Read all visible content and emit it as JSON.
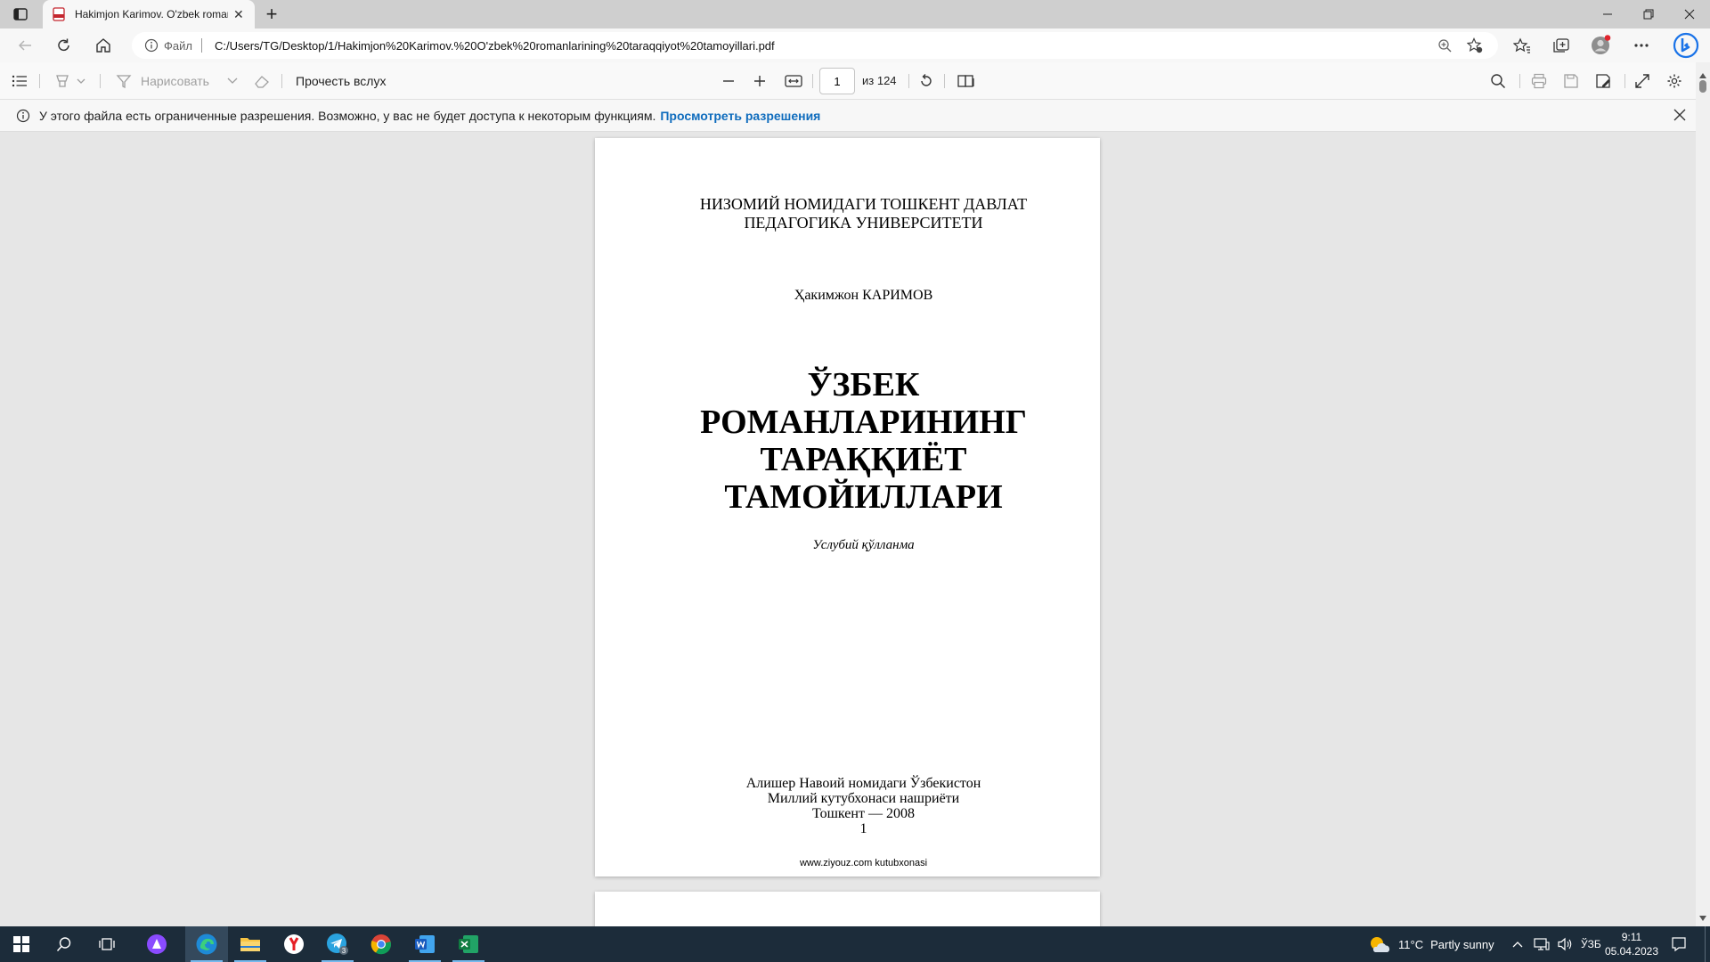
{
  "browser": {
    "tab": {
      "title": "Hakimjon Karimov. O'zbek romanlarining taraqqiyot tamoyillari.pdf",
      "close_glyph": "✕"
    },
    "new_tab_glyph": "+",
    "address": {
      "scheme_label": "Файл",
      "url": "C:/Users/TG/Desktop/1/Hakimjon%20Karimov.%20O'zbek%20romanlarining%20taraqqiyot%20tamoyillari.pdf"
    }
  },
  "pdf_toolbar": {
    "draw_label": "Нарисовать",
    "read_aloud_label": "Прочесть вслух",
    "page_current": "1",
    "page_of": "из 124"
  },
  "banner": {
    "message": "У этого файла есть ограниченные разрешения. Возможно, у вас не будет доступа к некоторым функциям.",
    "link": "Просмотреть разрешения"
  },
  "document": {
    "university_line1": "НИЗОМИЙ НОМИДАГИ ТОШКЕНТ ДАВЛАТ",
    "university_line2": "ПЕДАГОГИКА УНИВЕРСИТЕТИ",
    "author": "Ҳакимжон КАРИМОВ",
    "title_line1": "ЎЗБЕК",
    "title_line2": "РОМАНЛАРИНИНГ",
    "title_line3": "ТАРАҚҚИЁТ",
    "title_line4": "ТАМОЙИЛЛАРИ",
    "subtitle": "Услубий қўлланма",
    "publisher_line1": "Алишер Навоий номидаги Ўзбекистон",
    "publisher_line2": "Миллий кутубхонаси нашриёти",
    "publisher_line3": "Тошкент — 2008",
    "page_number": "1",
    "footer": "www.ziyouz.com kutubxonasi"
  },
  "taskbar": {
    "weather_temp": "11°C",
    "weather_text": "Partly sunny",
    "language": "ЎЗБ",
    "time": "9:11",
    "date": "05.04.2023",
    "telegram_badge": "3"
  },
  "colors": {
    "link": "#0f6cbd",
    "taskbar": "#1c2c3a",
    "bing": "#1a73e8"
  }
}
